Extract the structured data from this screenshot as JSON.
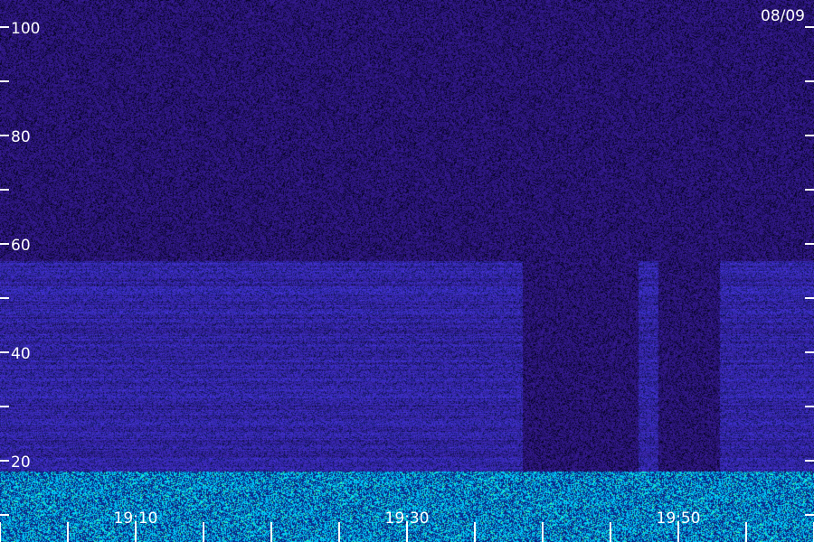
{
  "chart_data": {
    "type": "heatmap",
    "date_label": "08/09",
    "y_ticks": [
      {
        "value": 100,
        "label": "100"
      },
      {
        "value": 90,
        "label": ""
      },
      {
        "value": 80,
        "label": "80"
      },
      {
        "value": 70,
        "label": ""
      },
      {
        "value": 60,
        "label": "60"
      },
      {
        "value": 50,
        "label": ""
      },
      {
        "value": 40,
        "label": "40"
      },
      {
        "value": 30,
        "label": ""
      },
      {
        "value": 20,
        "label": "20"
      },
      {
        "value": 10,
        "label": ""
      }
    ],
    "ylim": [
      5,
      105
    ],
    "x_ticks_major": [
      {
        "minute": 10,
        "label": "19:10"
      },
      {
        "minute": 30,
        "label": "19:30"
      },
      {
        "minute": 50,
        "label": "19:50"
      }
    ],
    "xlim_minutes": [
      0,
      60
    ],
    "minor_tick_step_minutes": 5,
    "colors": {
      "background_noise": "#1c0f5a",
      "mid_band": "#3a2bd8",
      "low_band": "#00c8ff",
      "strong": "#40ff90",
      "text": "#ffffff"
    }
  }
}
